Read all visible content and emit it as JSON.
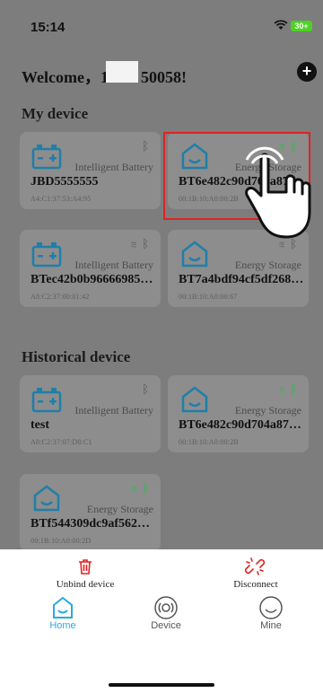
{
  "status_bar": {
    "time": "15:14",
    "battery": "30+"
  },
  "header": {
    "welcome_prefix": "Welcome，1",
    "welcome_suffix": "50058!"
  },
  "my_device": {
    "title": "My device",
    "cards": [
      {
        "type": "Intelligent Battery",
        "name": "JBD5555555",
        "mac": "A4:C1:37:53:A4:95"
      },
      {
        "type": "Energy Storage",
        "name": "BT6e482c90d704a87…",
        "mac": "00:1B:10:A0:00:2B"
      },
      {
        "type": "Intelligent Battery",
        "name": "BTec42b0b96666985…",
        "mac": "A8:C2:37:00:01:42"
      },
      {
        "type": "Energy Storage",
        "name": "BT7a4bdf94cf5df268…",
        "mac": "00:1B:10:A0:00:67"
      }
    ]
  },
  "historical_device": {
    "title": "Historical device",
    "cards": [
      {
        "type": "Intelligent Battery",
        "name": "test",
        "mac": "A8:C2:37:07:D8:C1"
      },
      {
        "type": "Energy Storage",
        "name": "BT6e482c90d704a87…",
        "mac": "00:1B:10:A0:00:2B"
      },
      {
        "type": "Energy Storage",
        "name": "BTf544309dc9af562…",
        "mac": "00:1B:10:A0:00:2D"
      }
    ]
  },
  "actions": {
    "unbind": "Unbind device",
    "disconnect": "Disconnect"
  },
  "tabbar": {
    "home": "Home",
    "device": "Device",
    "mine": "Mine"
  },
  "colors": {
    "accent": "#2aa9e0",
    "signal": "#22c043",
    "danger": "#e02222"
  }
}
